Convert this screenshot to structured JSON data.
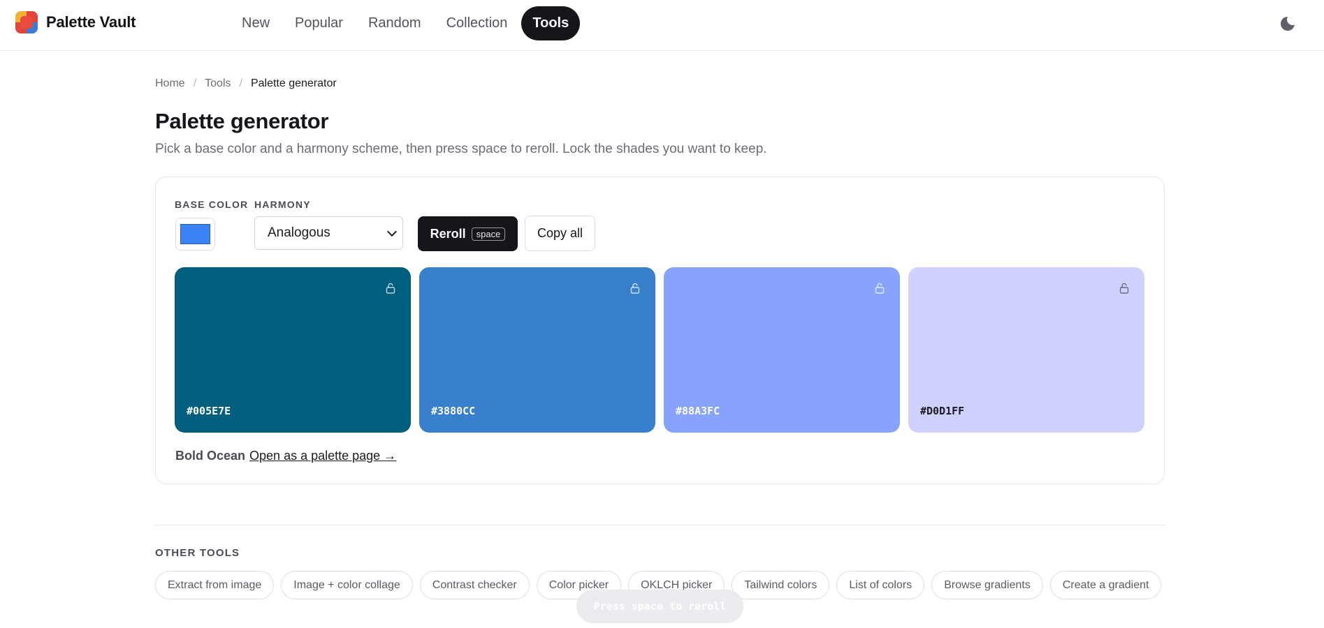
{
  "header": {
    "brand_name": "Palette Vault",
    "nav": [
      {
        "label": "New",
        "active": false
      },
      {
        "label": "Popular",
        "active": false
      },
      {
        "label": "Random",
        "active": false
      },
      {
        "label": "Collection",
        "active": false
      },
      {
        "label": "Tools",
        "active": true
      }
    ],
    "theme_toggle_icon": "moon-icon"
  },
  "breadcrumb": [
    "Home",
    "Tools",
    "Palette generator"
  ],
  "page": {
    "title": "Palette generator",
    "subtitle": "Pick a base color and a harmony scheme, then press space to reroll. Lock the shades you want to keep."
  },
  "controls": {
    "base_color_label": "BASE COLOR",
    "base_color_value": "#3B82F6",
    "harmony_label": "HARMONY",
    "harmony_selected": "Analogous",
    "reroll_label": "Reroll",
    "reroll_shortcut": "space",
    "copy_all_label": "Copy all"
  },
  "swatches": [
    {
      "hex": "#005E7E",
      "bg": "#005E7E",
      "text_color": "#FFFFFF",
      "locked": false
    },
    {
      "hex": "#3880CC",
      "bg": "#3880CC",
      "text_color": "#FFFFFF",
      "locked": false
    },
    {
      "hex": "#88A3FC",
      "bg": "#88A3FC",
      "text_color": "#FFFFFF",
      "locked": false
    },
    {
      "hex": "#D0D1FF",
      "bg": "#D0D1FF",
      "text_color": "#1B1C21",
      "locked": false
    }
  ],
  "palette_meta": {
    "name": "Bold Ocean",
    "link": "Open as a palette page →"
  },
  "other_tools": {
    "label": "OTHER TOOLS",
    "items": [
      "Extract from image",
      "Image + color collage",
      "Contrast checker",
      "Color picker",
      "OKLCH picker",
      "Tailwind colors",
      "List of colors",
      "Browse gradients",
      "Create a gradient"
    ]
  },
  "toast": "Press space to reroll"
}
